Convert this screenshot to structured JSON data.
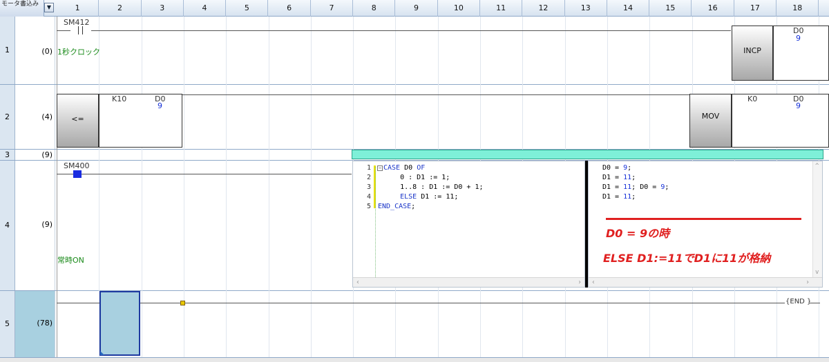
{
  "header": {
    "mode_label": "モータ書込み",
    "columns": [
      "1",
      "2",
      "3",
      "4",
      "5",
      "6",
      "7",
      "8",
      "9",
      "10",
      "11",
      "12",
      "13",
      "14",
      "15",
      "16",
      "17",
      "18"
    ]
  },
  "rows": [
    {
      "row": "1",
      "step": "(0)",
      "contact": "SM412",
      "comment": "1秒クロック",
      "instruction": "INCP",
      "operand": "D0",
      "operand_value": "9"
    },
    {
      "row": "2",
      "step": "(4)",
      "compare_op": "<=",
      "compare_s1": "K10",
      "compare_s2": "D0",
      "compare_s2_value": "9",
      "instruction": "MOV",
      "mov_src": "K0",
      "mov_dst": "D0",
      "mov_dst_value": "9"
    },
    {
      "row": "3",
      "step": "(9)"
    },
    {
      "row": "4",
      "step": "(9)",
      "contact": "SM400",
      "comment": "常時ON"
    },
    {
      "row": "5",
      "step": "(78)",
      "end": "END"
    }
  ],
  "st_editor": {
    "line_numbers": [
      "1",
      "2",
      "3",
      "4",
      "5"
    ],
    "code": [
      {
        "kw1": "CASE",
        "text": " D0 ",
        "kw2": "OF"
      },
      {
        "kw1": "",
        "text": "    0 : D1 := 1;",
        "kw2": ""
      },
      {
        "kw1": "",
        "text": "    1..8 : D1 := D0 + 1;",
        "kw2": ""
      },
      {
        "kw1": "    ELSE",
        "text": " D1 := 11;",
        "kw2": ""
      },
      {
        "kw1": "END_CASE",
        "text": ";",
        "kw2": ""
      }
    ],
    "monitor": [
      {
        "name": "D0 = ",
        "value": "9",
        "tail": ";"
      },
      {
        "name": "D1 = ",
        "value": "11",
        "tail": ";"
      },
      {
        "name": "D1 = ",
        "value": "11",
        "tail": "; D0 = ",
        "value2": "9",
        "tail2": ";"
      },
      {
        "name": "D1 = ",
        "value": "11",
        "tail": ";"
      }
    ]
  },
  "annotation": {
    "line1": "D0 = 9の時",
    "line2": "ELSE D1:=11でD1に11が格納",
    "color": "#e02020"
  }
}
